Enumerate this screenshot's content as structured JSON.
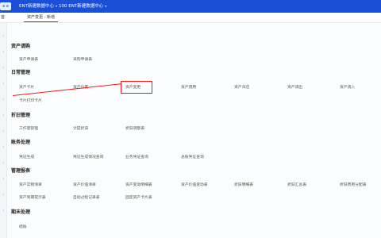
{
  "topbar": {
    "logo_text": "≡ ≡",
    "ctx_left": "ENT新建数据中心",
    "ctx_right_code": "100",
    "ctx_right": "ENT新建数据中心"
  },
  "breadcrumb": {
    "left": "首",
    "tab": "资产变更 - 新增"
  },
  "sections": {
    "s1": {
      "title": "资产请购",
      "items": [
        "资产申请表",
        "采购申请表"
      ]
    },
    "s2": {
      "title": "日常管理",
      "items": [
        "资产卡片",
        "资产位置",
        "资产变更",
        "资产借用",
        "资产归还",
        "资产调出",
        "资产调入",
        "卡片打印卡片"
      ]
    },
    "s3": {
      "title": "折旧管理",
      "items": [
        "工作量管理",
        "计提折旧",
        "折旧调整表"
      ]
    },
    "s4": {
      "title": "账务处理",
      "items": [
        "凭证生成",
        "凭证生成情况查询",
        "业务凭证查询",
        "总账凭证查询"
      ]
    },
    "s5": {
      "title": "管理报表",
      "items": [
        "资产实物清单",
        "资产价值清单",
        "资产变动明细表",
        "资产价值变动表",
        "折旧明细表",
        "折旧汇总表",
        "折旧费用分配表",
        "资产到期提示表",
        "自动过程记录表",
        "固定资产卡片表"
      ]
    },
    "s6": {
      "title": "期末处理",
      "items": [
        "结账"
      ]
    }
  },
  "annotation_color": "#e02020",
  "accent_color": "#1a4fd6"
}
